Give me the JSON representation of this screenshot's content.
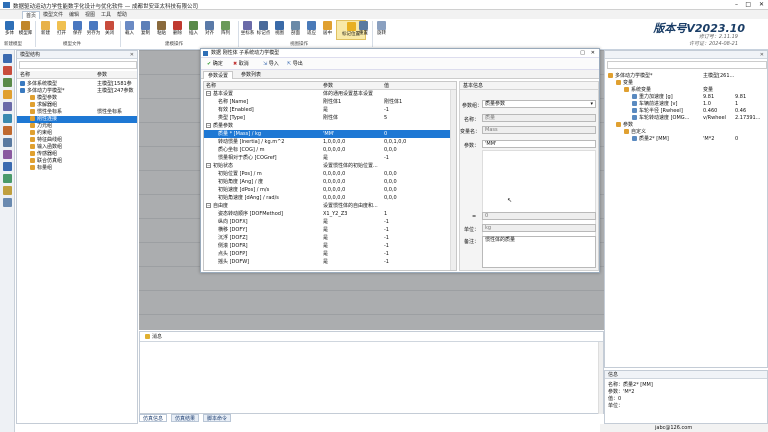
{
  "window": {
    "title": "数据驱动运动力学性能数字化设计与优化软件 — 成都世安亚太科技有限公司"
  },
  "ribbon_tabs": [
    "首页",
    "模型文件",
    "编辑",
    "视图",
    "工具",
    "帮助"
  ],
  "ribbon_buttons": [
    {
      "name": "new-model",
      "label": "多体",
      "color": "#2e6fb7"
    },
    {
      "name": "model-library",
      "label": "模型库",
      "color": "#c0862a"
    },
    {
      "name": "new",
      "label": "新建",
      "color": "#e8b24a"
    },
    {
      "name": "open",
      "label": "打开",
      "color": "#f0c050"
    },
    {
      "name": "save",
      "label": "保存",
      "color": "#4a78c0"
    },
    {
      "name": "save-as",
      "label": "另存为",
      "color": "#4a78c0"
    },
    {
      "name": "close",
      "label": "关闭",
      "color": "#c84c3c"
    },
    {
      "name": "import",
      "label": "载入",
      "color": "#6a8ac4"
    },
    {
      "name": "copy",
      "label": "复制",
      "color": "#5c7fb8"
    },
    {
      "name": "paste",
      "label": "粘贴",
      "color": "#8a6a3c"
    },
    {
      "name": "delete",
      "label": "删除",
      "color": "#c03a30"
    },
    {
      "name": "insert",
      "label": "插入",
      "color": "#5a8a4a"
    },
    {
      "name": "align",
      "label": "对齐",
      "color": "#5a7aa8"
    },
    {
      "name": "array",
      "label": "阵列",
      "color": "#6a9a5a"
    },
    {
      "name": "coordinate",
      "label": "坐标系",
      "color": "#6a6aa8"
    },
    {
      "name": "point",
      "label": "标记点",
      "color": "#4a6a9a"
    },
    {
      "name": "view",
      "label": "视图",
      "color": "#3a6aa8"
    },
    {
      "name": "section",
      "label": "剖面",
      "color": "#6a8aa8"
    },
    {
      "name": "fit",
      "label": "适应",
      "color": "#4a7ab8"
    },
    {
      "name": "center",
      "label": "居中",
      "color": "#e0a030"
    },
    {
      "name": "mark",
      "label": "标记位置",
      "color": "#e8b020"
    },
    {
      "name": "reset",
      "label": "重置",
      "color": "#5a7aa0"
    },
    {
      "name": "rotate",
      "label": "旋转",
      "color": "#8aa0c0"
    }
  ],
  "ribbon_groups": [
    "新建模型",
    "模型文件",
    "建模操作",
    "视图操作"
  ],
  "version": {
    "title": "版本号V2023.10",
    "build": "修订号：2.11.19",
    "license": "许可证：2024-08-21"
  },
  "left_panel": {
    "title": "模型结构",
    "col_name": "名称",
    "col_param": "参数",
    "rows": [
      {
        "label": "多体系统模型",
        "param": "主模型[1581参",
        "level": 0
      },
      {
        "label": "多体动力学模型*",
        "param": "主模型[247参数",
        "level": 0
      },
      {
        "label": "模型参数",
        "param": "",
        "level": 1
      },
      {
        "label": "求解器组",
        "param": "",
        "level": 1
      },
      {
        "label": "惯性坐标系",
        "param": "惯性坐标系",
        "level": 1
      },
      {
        "label": "刚性连接",
        "param": "",
        "level": 1,
        "selected": true
      },
      {
        "label": "力元组",
        "param": "",
        "level": 1
      },
      {
        "label": "约束组",
        "param": "",
        "level": 1
      },
      {
        "label": "特征曲线组",
        "param": "",
        "level": 1
      },
      {
        "label": "输入函数组",
        "param": "",
        "level": 1
      },
      {
        "label": "传感器组",
        "param": "",
        "level": 1
      },
      {
        "label": "联合仿真组",
        "param": "",
        "level": 1
      },
      {
        "label": "标量组",
        "param": "",
        "level": 1
      }
    ]
  },
  "dialog": {
    "title": "数据 刚性体 子系统动力学模型",
    "toolbar": {
      "ok": "确定",
      "cancel": "取消",
      "import": "导入",
      "export": "导出"
    },
    "tabs": [
      "参数设置",
      "参数列表"
    ],
    "columns": {
      "name": "名称",
      "param": "参数",
      "value": "值"
    },
    "rows": [
      {
        "label": "基本设置",
        "param": "体的通用设置基本设置",
        "value": "",
        "group": true
      },
      {
        "label": "名称 [Name]",
        "param": "刚性体1",
        "value": "刚性体1"
      },
      {
        "label": "有效 [Enabled]",
        "param": "是",
        "value": "-1"
      },
      {
        "label": "类型 [Type]",
        "param": "刚性体",
        "value": "5"
      },
      {
        "label": "质量参数",
        "param": "",
        "value": "",
        "group": true
      },
      {
        "label": "质量 * [Mass] / kg",
        "param": "'MM'",
        "value": "0",
        "selected": true
      },
      {
        "label": "转动惯量 [Inertia] / kg.m^2",
        "param": "1,0,0,0,0",
        "value": "0,0,1,0,0"
      },
      {
        "label": "质心坐标 [COG] / m",
        "param": "0,0,0,0,0",
        "value": "0,0,0"
      },
      {
        "label": "惯量相对于质心 [COGref]",
        "param": "是",
        "value": "-1"
      },
      {
        "label": "初始状态",
        "param": "设置惯性体的初始位置...",
        "value": "",
        "group": true
      },
      {
        "label": "初始位置 [Pos] / m",
        "param": "0,0,0,0,0",
        "value": "0,0,0"
      },
      {
        "label": "初始角度 [Ang] / 度",
        "param": "0,0,0,0,0",
        "value": "0,0,0"
      },
      {
        "label": "初始速度 [dPos] / m/s",
        "param": "0,0,0,0,0",
        "value": "0,0,0"
      },
      {
        "label": "初始角速度 [dAng] / rad/s",
        "param": "0,0,0,0,0",
        "value": "0,0,0"
      },
      {
        "label": "自由度",
        "param": "设置惯性体的自由度和...",
        "value": "",
        "group": true
      },
      {
        "label": "姿态转动顺序 [DOFMethod]",
        "param": "X1_Y2_Z3",
        "value": "1"
      },
      {
        "label": "纵向 [DOFX]",
        "param": "是",
        "value": "-1"
      },
      {
        "label": "横移 [DOFY]",
        "param": "是",
        "value": "-1"
      },
      {
        "label": "沉浮 [DOFZ]",
        "param": "是",
        "value": "-1"
      },
      {
        "label": "侧滚 [DOFR]",
        "param": "是",
        "value": "-1"
      },
      {
        "label": "点头 [DOFP]",
        "param": "是",
        "value": "-1"
      },
      {
        "label": "摇头 [DOFW]",
        "param": "是",
        "value": "-1"
      }
    ],
    "info": {
      "title": "基本信息",
      "param_group_label": "参数组：",
      "param_group_value": "质量参数",
      "name_label": "名称：",
      "name_value": "质量",
      "var_label": "变量名：",
      "var_value": "Mass",
      "param_label": "参数：",
      "param_value": "'MM'",
      "eq_label": "=",
      "eq_value": "0",
      "unit_label": "单位：",
      "unit_value": "kg",
      "note_label": "备注：",
      "note_value": "惯性体的质量"
    }
  },
  "right_panel": {
    "rows": [
      {
        "label": "多体动力学模型*",
        "c1": "主模型[261...",
        "c2": "",
        "level": 0
      },
      {
        "label": "变量",
        "c1": "",
        "c2": "",
        "level": 1
      },
      {
        "label": "系统变量",
        "c1": "变量",
        "c2": "",
        "level": 2
      },
      {
        "label": "重力加速度 [g]",
        "c1": "9.81",
        "c2": "9.81",
        "level": 3
      },
      {
        "label": "车辆前进速度 [v]",
        "c1": "1.0",
        "c2": "1",
        "level": 3
      },
      {
        "label": "车轮半径 [Rwheel]",
        "c1": "0.460",
        "c2": "0.46",
        "level": 3
      },
      {
        "label": "车轮转动速度 [OMG...",
        "c1": "v/Rwheel",
        "c2": "2.17391...",
        "level": 3
      },
      {
        "label": "参数",
        "c1": "",
        "c2": "",
        "level": 1
      },
      {
        "label": "自定义",
        "c1": "",
        "c2": "",
        "level": 2
      },
      {
        "label": "质量2* [MM]",
        "c1": "'M*2",
        "c2": "0",
        "level": 3
      }
    ]
  },
  "right_info": {
    "title": "信息",
    "name_label": "名称：",
    "name_value": "质量2* [MM]",
    "param_label": "参数：",
    "param_value": "'M*2",
    "value_label": "值：",
    "value_value": "0",
    "unit_label": "单位："
  },
  "message_panel": {
    "title": "消息"
  },
  "bottom_tabs": [
    "仿真信息",
    "仿真结果",
    "脚本命令"
  ],
  "status": {
    "email": "jabc@126.com"
  }
}
